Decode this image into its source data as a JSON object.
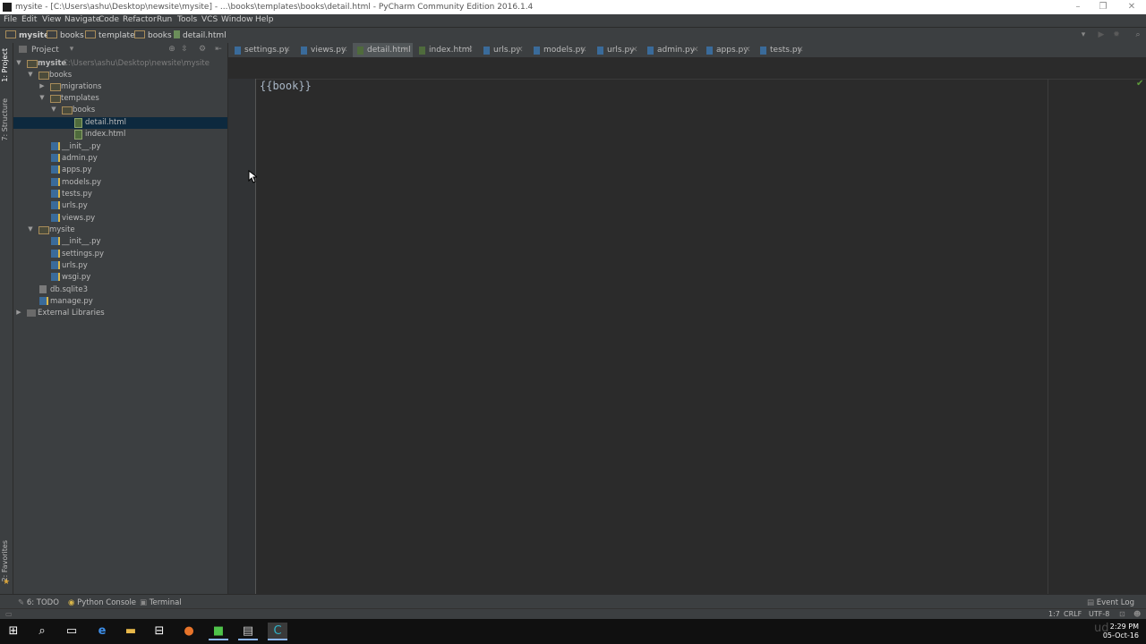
{
  "window": {
    "title": "mysite - [C:\\Users\\ashu\\Desktop\\newsite\\mysite] - ...\\books\\templates\\books\\detail.html - PyCharm Community Edition 2016.1.4"
  },
  "menu": [
    "File",
    "Edit",
    "View",
    "Navigate",
    "Code",
    "Refactor",
    "Run",
    "Tools",
    "VCS",
    "Window",
    "Help"
  ],
  "breadcrumbs": [
    "mysite",
    "books",
    "templates",
    "books",
    "detail.html"
  ],
  "left_strip": {
    "project_tab": "1: Project",
    "structure_tab": "7: Structure",
    "favorites_tab": "2: Favorites"
  },
  "project_panel": {
    "view_selector": "Project",
    "tree": [
      {
        "label": "mysite",
        "path": "C:\\Users\\ashu\\Desktop\\newsite\\mysite",
        "icon": "folder",
        "expanded": true
      },
      {
        "label": "books",
        "icon": "folder",
        "expanded": true
      },
      {
        "label": "migrations",
        "icon": "folder",
        "expanded": false
      },
      {
        "label": "templates",
        "icon": "folder",
        "expanded": true
      },
      {
        "label": "books",
        "icon": "folder",
        "expanded": true
      },
      {
        "label": "detail.html",
        "icon": "html-file",
        "selected": true
      },
      {
        "label": "index.html",
        "icon": "html-file"
      },
      {
        "label": "__init__.py",
        "icon": "python-file"
      },
      {
        "label": "admin.py",
        "icon": "python-file"
      },
      {
        "label": "apps.py",
        "icon": "python-file"
      },
      {
        "label": "models.py",
        "icon": "python-file"
      },
      {
        "label": "tests.py",
        "icon": "python-file"
      },
      {
        "label": "urls.py",
        "icon": "python-file"
      },
      {
        "label": "views.py",
        "icon": "python-file"
      },
      {
        "label": "mysite",
        "icon": "folder",
        "expanded": true
      },
      {
        "label": "__init__.py",
        "icon": "python-file"
      },
      {
        "label": "settings.py",
        "icon": "python-file"
      },
      {
        "label": "urls.py",
        "icon": "python-file"
      },
      {
        "label": "wsgi.py",
        "icon": "python-file"
      },
      {
        "label": "db.sqlite3",
        "icon": "database-file"
      },
      {
        "label": "manage.py",
        "icon": "python-file"
      },
      {
        "label": "External Libraries",
        "icon": "library",
        "expanded": false
      }
    ]
  },
  "tabs": [
    {
      "label": "settings.py",
      "icon": "python-file"
    },
    {
      "label": "views.py",
      "icon": "python-file"
    },
    {
      "label": "detail.html",
      "icon": "html-file",
      "active": true
    },
    {
      "label": "index.html",
      "icon": "html-file"
    },
    {
      "label": "urls.py",
      "icon": "python-file"
    },
    {
      "label": "models.py",
      "icon": "python-file"
    },
    {
      "label": "urls.py",
      "icon": "python-file"
    },
    {
      "label": "admin.py",
      "icon": "python-file"
    },
    {
      "label": "apps.py",
      "icon": "python-file"
    },
    {
      "label": "tests.py",
      "icon": "python-file"
    }
  ],
  "editor": {
    "code": "{{book}}"
  },
  "bottom_tools": {
    "todo": "6: TODO",
    "python_console": "Python Console",
    "terminal": "Terminal",
    "event_log": "Event Log"
  },
  "status": {
    "position": "1:7",
    "line_separator": "CRLF",
    "encoding": "UTF-8"
  },
  "taskbar": {
    "time": "2:29 PM",
    "date": "05-Oct-16",
    "apps": [
      "start-icon",
      "search-icon",
      "task-view-icon",
      "edge-icon",
      "file-explorer-icon",
      "store-icon",
      "firefox-icon",
      "pycharm-icon",
      "cmd-icon",
      "app-icon"
    ]
  },
  "watermark": "ud"
}
